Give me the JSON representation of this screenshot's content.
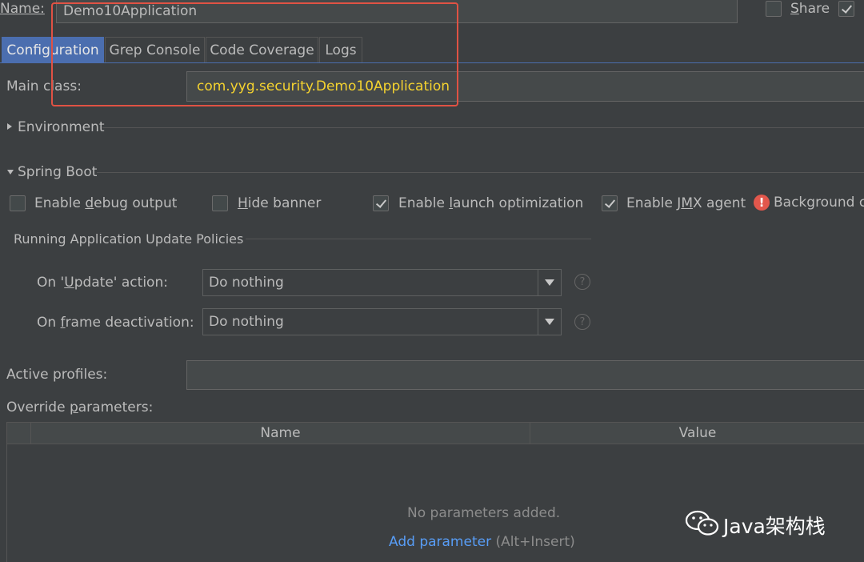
{
  "name_row": {
    "label": "Name:",
    "value": "Demo10Application",
    "share_label": "Share"
  },
  "tabs": [
    {
      "label": "Configuration",
      "active": true
    },
    {
      "label": "Grep Console",
      "active": false
    },
    {
      "label": "Code Coverage",
      "active": false
    },
    {
      "label": "Logs",
      "active": false
    }
  ],
  "main_class": {
    "label": "Main class:",
    "value": "com.yyg.security.Demo10Application",
    "value_color": "#f5d32f"
  },
  "environment": {
    "label": "Environment"
  },
  "spring_boot": {
    "label": "Spring Boot",
    "options": [
      {
        "pre": "Enable ",
        "mn": "d",
        "post": "ebug output",
        "checked": false
      },
      {
        "pre": "",
        "mn": "H",
        "post": "ide banner",
        "checked": false
      },
      {
        "pre": "Enable ",
        "mn": "l",
        "post": "aunch optimization",
        "checked": true
      },
      {
        "pre": "Enable J",
        "mn": "M",
        "post": "X agent",
        "checked": true
      }
    ],
    "background_text": "Background c"
  },
  "update_policies": {
    "title": "Running Application Update Policies",
    "update_action": {
      "pre": "On '",
      "mn": "U",
      "post": "pdate' action:",
      "value": "Do nothing"
    },
    "frame_deactivation": {
      "pre": "On ",
      "mn": "f",
      "post": "rame deactivation:",
      "value": "Do nothing"
    }
  },
  "active_profiles": {
    "label": "Active profiles:",
    "value": ""
  },
  "override": {
    "pre": "Override ",
    "mn": "p",
    "post": "arameters:",
    "columns": [
      "Name",
      "Value"
    ],
    "empty_text": "No parameters added.",
    "add_link": "Add parameter",
    "add_shortcut": "(Alt+Insert)"
  },
  "watermark": {
    "text": "Java架构栈"
  },
  "colors": {
    "background": "#3c3f41",
    "active_tab": "#4b6eaf",
    "link": "#589df6",
    "highlight_box": "#e05244"
  }
}
